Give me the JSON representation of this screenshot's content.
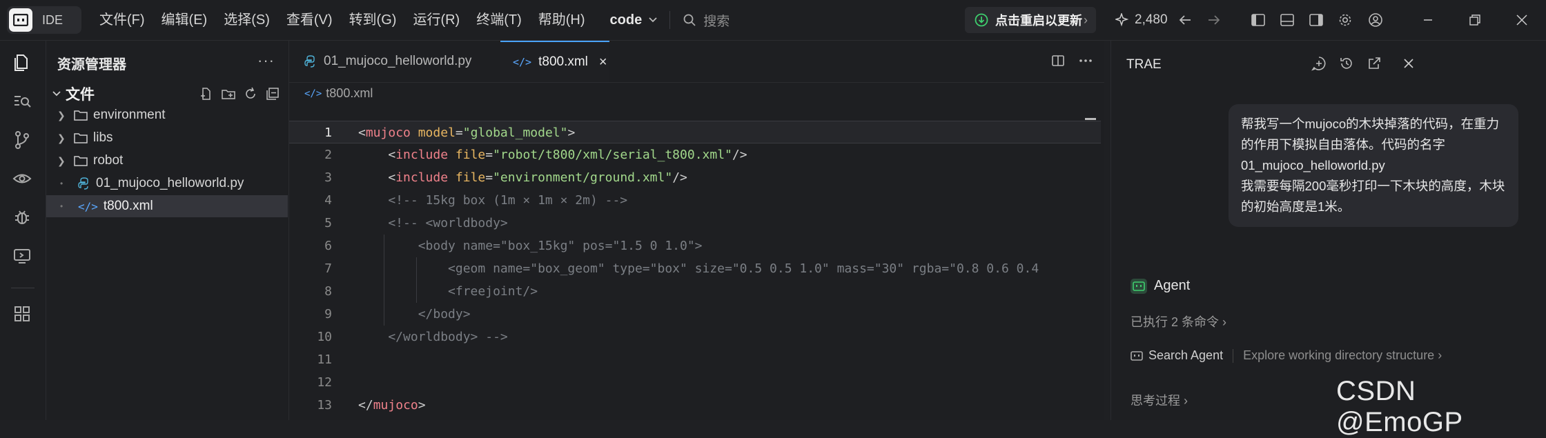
{
  "titlebar": {
    "logo_text": "IDE",
    "menu": [
      "文件(F)",
      "编辑(E)",
      "选择(S)",
      "查看(V)",
      "转到(G)",
      "运行(R)",
      "终端(T)",
      "帮助(H)"
    ],
    "project": "code",
    "search_placeholder": "搜索",
    "update_label": "点击重启以更新",
    "stars": "2,480"
  },
  "explorer": {
    "title": "资源管理器",
    "more": "···",
    "root": "文件",
    "items": [
      {
        "type": "folder",
        "label": "environment"
      },
      {
        "type": "folder",
        "label": "libs"
      },
      {
        "type": "folder",
        "label": "robot"
      },
      {
        "type": "python",
        "label": "01_mujoco_helloworld.py"
      },
      {
        "type": "xml",
        "label": "t800.xml",
        "selected": true
      }
    ]
  },
  "editor": {
    "tabs": [
      {
        "label": "01_mujoco_helloworld.py",
        "active": false
      },
      {
        "label": "t800.xml",
        "active": true,
        "close": "×"
      }
    ],
    "breadcrumb": "t800.xml",
    "lines": [
      {
        "n": "1",
        "tokens": [
          [
            "t-punc",
            "<"
          ],
          [
            "t-tag",
            "mujoco"
          ],
          [
            "t-punc",
            " "
          ],
          [
            "t-attr",
            "model"
          ],
          [
            "t-punc",
            "="
          ],
          [
            "t-str",
            "\"global_model\""
          ],
          [
            "t-punc",
            ">"
          ]
        ]
      },
      {
        "n": "2",
        "tokens": [
          [
            "t-punc",
            "    <"
          ],
          [
            "t-tag",
            "include"
          ],
          [
            "t-punc",
            " "
          ],
          [
            "t-attr",
            "file"
          ],
          [
            "t-punc",
            "="
          ],
          [
            "t-str",
            "\"robot/t800/xml/serial_t800.xml\""
          ],
          [
            "t-punc",
            "/>"
          ]
        ]
      },
      {
        "n": "3",
        "tokens": [
          [
            "t-punc",
            "    <"
          ],
          [
            "t-tag",
            "include"
          ],
          [
            "t-punc",
            " "
          ],
          [
            "t-attr",
            "file"
          ],
          [
            "t-punc",
            "="
          ],
          [
            "t-str",
            "\"environment/ground.xml\""
          ],
          [
            "t-punc",
            "/>"
          ]
        ]
      },
      {
        "n": "4",
        "tokens": [
          [
            "t-com",
            "    <!-- 15kg box (1m × 1m × 2m) -->"
          ]
        ]
      },
      {
        "n": "5",
        "tokens": [
          [
            "t-com",
            "    <!-- <worldbody>"
          ]
        ]
      },
      {
        "n": "6",
        "tokens": [
          [
            "t-com",
            "        <body name=\"box_15kg\" pos=\"1.5 0 1.0\">"
          ]
        ]
      },
      {
        "n": "7",
        "tokens": [
          [
            "t-com",
            "            <geom name=\"box_geom\" type=\"box\" size=\"0.5 0.5 1.0\" mass=\"30\" rgba=\"0.8 0.6 0.4"
          ]
        ]
      },
      {
        "n": "8",
        "tokens": [
          [
            "t-com",
            "            <freejoint/>"
          ]
        ]
      },
      {
        "n": "9",
        "tokens": [
          [
            "t-com",
            "        </body>"
          ]
        ]
      },
      {
        "n": "10",
        "tokens": [
          [
            "t-com",
            "    </worldbody> -->"
          ]
        ]
      },
      {
        "n": "11",
        "tokens": []
      },
      {
        "n": "12",
        "tokens": []
      },
      {
        "n": "13",
        "tokens": [
          [
            "t-punc",
            "</"
          ],
          [
            "t-tag",
            "mujoco"
          ],
          [
            "t-punc",
            ">"
          ]
        ]
      }
    ]
  },
  "trae": {
    "title": "TRAE",
    "user_message": [
      "帮我写一个mujoco的木块掉落的代码，在重力的作用下模拟自由落体。代码的名字01_mujoco_helloworld.py",
      "我需要每隔200毫秒打印一下木块的高度，木块的初始高度是1米。"
    ],
    "agent_label": "Agent",
    "executed": "已执行 2 条命令",
    "search_agent": "Search Agent",
    "search_desc": "Explore working directory structure",
    "thinking": "思考过程"
  },
  "watermark": "CSDN @EmoGP",
  "colors": {
    "accent": "#4aa3ff",
    "update_icon": "#3ecf6e",
    "python_icon": "#4fb3d9",
    "xml_icon": "#5aa8ff"
  }
}
